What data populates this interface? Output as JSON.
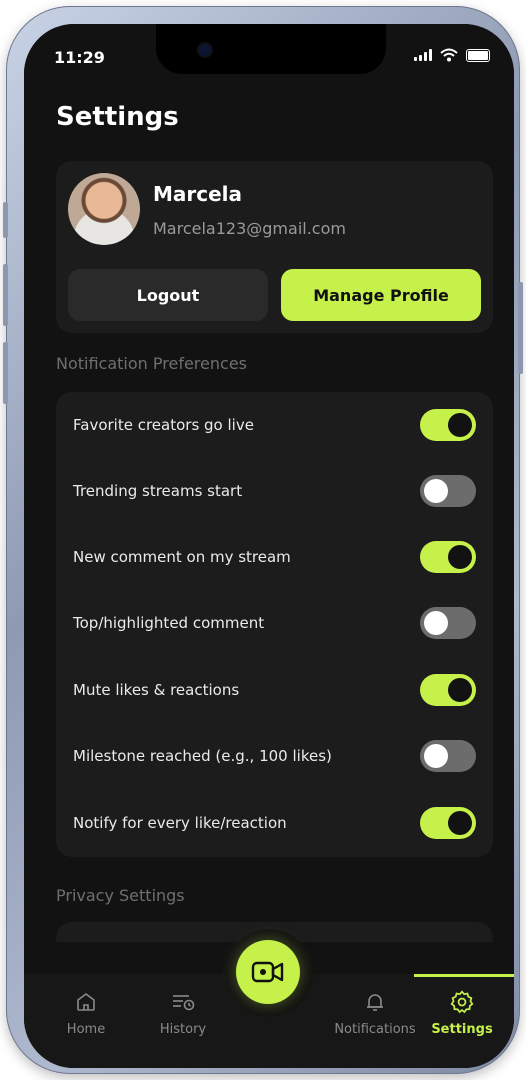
{
  "status_bar": {
    "time": "11:29"
  },
  "header": {
    "title": "Settings"
  },
  "profile": {
    "name": "Marcela",
    "email": "Marcela123@gmail.com",
    "logout_label": "Logout",
    "manage_label": "Manage Profile"
  },
  "notification_section": {
    "title": "Notification Preferences",
    "items": [
      {
        "label": "Favorite creators go live",
        "enabled": true
      },
      {
        "label": "Trending streams start",
        "enabled": false
      },
      {
        "label": "New comment on my stream",
        "enabled": true
      },
      {
        "label": "Top/highlighted comment",
        "enabled": false
      },
      {
        "label": "Mute likes & reactions",
        "enabled": true
      },
      {
        "label": "Milestone reached (e.g., 100 likes)",
        "enabled": false
      },
      {
        "label": "Notify for every like/reaction",
        "enabled": true
      }
    ]
  },
  "privacy_section": {
    "title": "Privacy Settings"
  },
  "bottom_nav": {
    "items": [
      {
        "label": "Home",
        "icon": "home-icon"
      },
      {
        "label": "History",
        "icon": "history-icon"
      },
      {
        "label": "Notifications",
        "icon": "bell-icon"
      },
      {
        "label": "Settings",
        "icon": "gear-icon",
        "active": true
      }
    ],
    "center_action_icon": "video-camera-icon"
  },
  "colors": {
    "accent": "#c6f04a",
    "background": "#121212",
    "card": "#1c1c1c"
  }
}
